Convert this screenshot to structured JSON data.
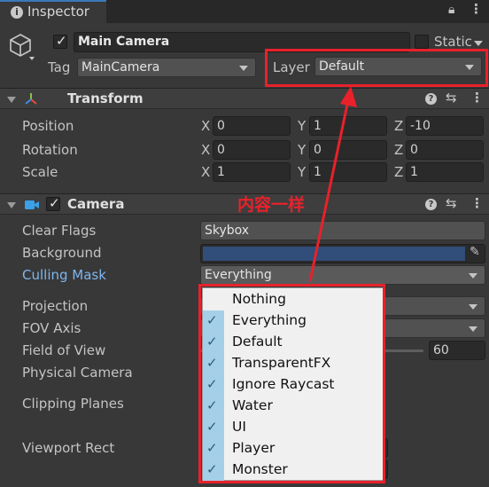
{
  "window": {
    "tab_title": "Inspector",
    "tab_icon": "info-icon"
  },
  "object": {
    "enabled": true,
    "name": "Main Camera",
    "static_label": "Static",
    "tag_label": "Tag",
    "tag_value": "MainCamera",
    "layer_label": "Layer",
    "layer_value": "Default"
  },
  "transform": {
    "title": "Transform",
    "rows": [
      {
        "label": "Position",
        "x": "0",
        "y": "1",
        "z": "-10"
      },
      {
        "label": "Rotation",
        "x": "0",
        "y": "0",
        "z": "0"
      },
      {
        "label": "Scale",
        "x": "1",
        "y": "1",
        "z": "1"
      }
    ],
    "axis_x": "X",
    "axis_y": "Y",
    "axis_z": "Z"
  },
  "camera": {
    "title": "Camera",
    "enabled": true,
    "clear_flags_label": "Clear Flags",
    "clear_flags_value": "Skybox",
    "background_label": "Background",
    "background_color": "#314d79",
    "culling_mask_label": "Culling Mask",
    "culling_mask_value": "Everything",
    "projection_label": "Projection",
    "fov_axis_label": "FOV Axis",
    "field_of_view_label": "Field of View",
    "field_of_view_value": "60",
    "physical_camera_label": "Physical Camera",
    "clipping_planes_label": "Clipping Planes",
    "viewport_rect_label": "Viewport Rect"
  },
  "culling_menu": {
    "items": [
      {
        "label": "Nothing",
        "checked": false
      },
      {
        "label": "Everything",
        "checked": true
      },
      {
        "label": "Default",
        "checked": true
      },
      {
        "label": "TransparentFX",
        "checked": true
      },
      {
        "label": "Ignore Raycast",
        "checked": true
      },
      {
        "label": "Water",
        "checked": true
      },
      {
        "label": "UI",
        "checked": true
      },
      {
        "label": "Player",
        "checked": true
      },
      {
        "label": "Monster",
        "checked": true
      }
    ]
  },
  "annotation": {
    "text": "内容一样",
    "color": "#e8212b"
  }
}
